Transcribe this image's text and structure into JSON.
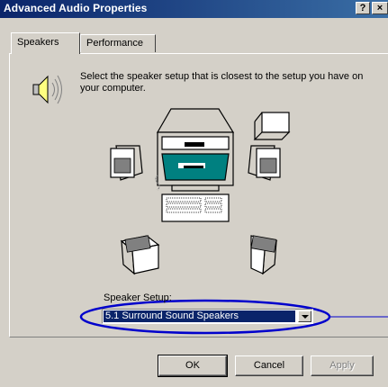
{
  "window": {
    "title": "Advanced Audio Properties",
    "help_glyph": "?",
    "close_glyph": "×"
  },
  "tabs": [
    {
      "label": "Speakers",
      "active": true
    },
    {
      "label": "Performance",
      "active": false
    }
  ],
  "speakers_tab": {
    "intro_text": "Select the speaker setup that is closest to the setup you have on your computer.",
    "speaker_setup_label": "Speaker Setup:",
    "speaker_setup_value": "5.1 Surround Sound Speakers"
  },
  "buttons": {
    "ok": "OK",
    "cancel": "Cancel",
    "apply": "Apply"
  },
  "icons": {
    "speaker_icon": "speaker-volume-icon",
    "diagram": "speaker-layout-diagram"
  },
  "colors": {
    "titlebar": "#0a246a",
    "face": "#d4d0c8",
    "highlight": "#0000cc",
    "screen": "#008080"
  }
}
